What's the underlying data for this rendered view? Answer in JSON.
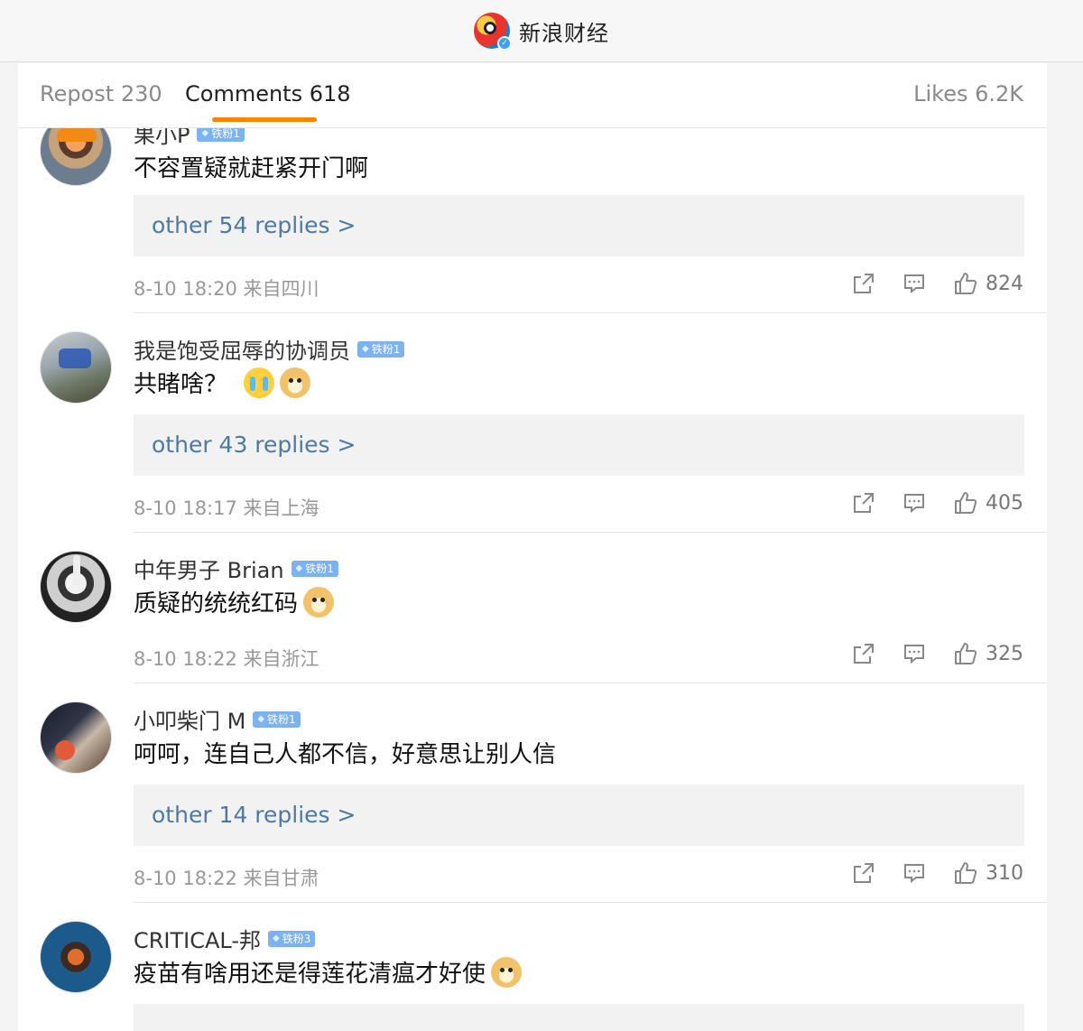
{
  "header": {
    "brand_name": "新浪财经",
    "logo_icon": "sina-weibo-eye-logo",
    "verified_mark": "✓"
  },
  "tabs": {
    "repost": "Repost 230",
    "comments": "Comments 618",
    "likes": "Likes 6.2K",
    "active": "comments",
    "accent_color": "#ff8200"
  },
  "comments": [
    {
      "username": "果小P",
      "badge": "铁粉1",
      "text": "不容置疑就赶紧开门啊",
      "replies": "other 54 replies >",
      "meta": "8-10 18:20  来自四川",
      "likes": "824"
    },
    {
      "username": "我是饱受屈辱的协调员",
      "badge": "铁粉1",
      "text": "共睹啥？",
      "emojis": [
        "cry",
        "doge"
      ],
      "replies": "other 43 replies >",
      "meta": "8-10 18:17  来自上海",
      "likes": "405"
    },
    {
      "username": "中年男子 Brian",
      "badge": "铁粉1",
      "text": "质疑的统统红码",
      "emojis": [
        "doge"
      ],
      "meta": "8-10 18:22  来自浙江",
      "likes": "325"
    },
    {
      "username": "小叩柴门 M",
      "badge": "铁粉1",
      "text": "呵呵，连自己人都不信，好意思让别人信",
      "replies": "other 14 replies >",
      "meta": "8-10 18:22  来自甘肃",
      "likes": "310"
    },
    {
      "username": "CRITICAL-邦",
      "badge": "铁粉3",
      "text": "疫苗有啥用还是得莲花清瘟才好使",
      "emojis": [
        "doge"
      ]
    }
  ],
  "colors": {
    "link": "#4d79a6",
    "badge": "#7cb2ef",
    "divider": "#e6e6e6"
  },
  "icons": {
    "share": "share-icon",
    "comment": "comment-icon",
    "like": "thumb-up-icon"
  }
}
